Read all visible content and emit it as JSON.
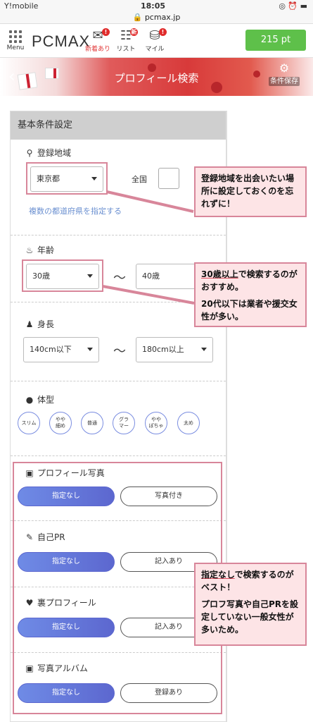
{
  "status": {
    "carrier": "Y!mobile",
    "time": "18:05",
    "right": "◎ ⏰ ▬"
  },
  "url": "🔒 pcmax.jp",
  "header": {
    "menu_label": "Menu",
    "logo": "PCMAX",
    "icons": [
      {
        "name": "新着あり",
        "icon": "envelope-icon",
        "badge": "!"
      },
      {
        "name": "リスト",
        "icon": "list-icon",
        "badge": "新"
      },
      {
        "name": "マイル",
        "icon": "coins-icon",
        "badge": "!"
      }
    ],
    "points": "215 pt"
  },
  "banner": {
    "title": "プロフィール検索",
    "save": "条件保存",
    "back": "‹"
  },
  "panel": {
    "title": "基本条件設定",
    "area": {
      "label": "登録地域",
      "value": "東京都",
      "national": "全国",
      "link": "複数の都道府県を指定する"
    },
    "age": {
      "label": "年齢",
      "from": "30歳",
      "to": "40歳",
      "tilde": "〜"
    },
    "height": {
      "label": "身長",
      "from": "140cm以下",
      "to": "180cm以上",
      "tilde": "〜"
    },
    "body": {
      "label": "体型",
      "options": [
        "スリム",
        "やや\n細め",
        "普通",
        "グラ\nマー",
        "やや\nぽちゃ",
        "太め"
      ]
    },
    "photo": {
      "label": "プロフィール写真",
      "opt1": "指定なし",
      "opt2": "写真付き"
    },
    "pr": {
      "label": "自己PR",
      "opt1": "指定なし",
      "opt2": "記入あり"
    },
    "ura": {
      "label": "裏プロフィール",
      "opt1": "指定なし",
      "opt2": "記入あり"
    },
    "album": {
      "label": "写真アルバム",
      "opt1": "指定なし",
      "opt2": "登録あり"
    }
  },
  "callouts": {
    "c1": "登録地域を出会いたい場所に設定しておくのを忘れずに！",
    "c2a_ul": "30歳以上",
    "c2a_rest": "で検索するのがおすすめ。",
    "c2b": "20代以下は業者や援交女性が多い。",
    "c3a_ul": "指定なし",
    "c3a_rest": "で検索するのがベスト！",
    "c3b": "プロフ写真や自己PRを設定していない一般女性が多いため。"
  }
}
